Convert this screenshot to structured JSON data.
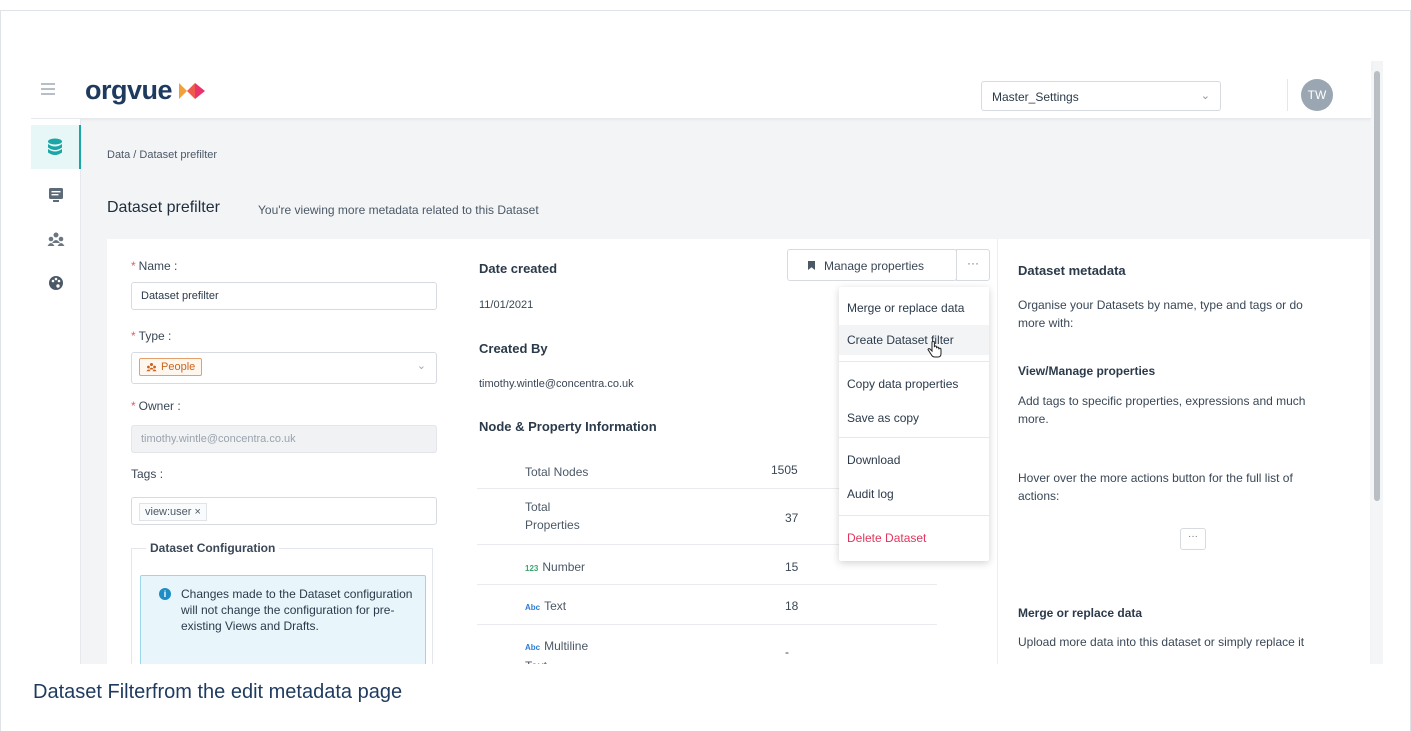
{
  "app": {
    "logo_text": "orgvue",
    "dataset_select": "Master_Settings",
    "avatar_initials": "TW"
  },
  "sidebar": {
    "items": [
      {
        "name": "data",
        "icon": "database-icon",
        "active": true
      },
      {
        "name": "views",
        "icon": "monitor-icon",
        "active": false
      },
      {
        "name": "people",
        "icon": "group-icon",
        "active": false
      },
      {
        "name": "palette",
        "icon": "palette-icon",
        "active": false
      }
    ]
  },
  "breadcrumb": "Data / Dataset prefilter",
  "page": {
    "title": "Dataset prefilter",
    "subtitle": "You're viewing more metadata related to this Dataset"
  },
  "form": {
    "name_label": "Name",
    "name_value": "Dataset prefilter",
    "type_label": "Type",
    "type_value": "People",
    "owner_label": "Owner",
    "owner_value": "timothy.wintle@concentra.co.uk",
    "tags_label": "Tags",
    "tag_value": "view:user",
    "tag_remove": "×",
    "config_title": "Dataset Configuration",
    "config_info": "Changes made to the Dataset configuration will not change the configuration for pre-existing Views and Drafts."
  },
  "details": {
    "date_created_label": "Date created",
    "date_created_value": "11/01/2021",
    "created_by_label": "Created By",
    "created_by_value": "timothy.wintle@concentra.co.uk",
    "node_info_label": "Node & Property Information",
    "rows": [
      {
        "type_badge": "",
        "label": "Total Nodes",
        "value": "1505"
      },
      {
        "type_badge": "",
        "label": "Total Properties",
        "value": "37"
      },
      {
        "type_badge": "123",
        "label": "Number",
        "value": "15"
      },
      {
        "type_badge": "Abc",
        "label": "Text",
        "value": "18"
      },
      {
        "type_badge": "Abc",
        "label": "Multiline Text",
        "value": "-"
      }
    ]
  },
  "actions": {
    "manage_label": "Manage properties",
    "more_label": "···",
    "menu": [
      "Merge or replace data",
      "Create Dataset filter",
      "Copy data properties",
      "Save as copy",
      "Download",
      "Audit log",
      "Delete Dataset"
    ]
  },
  "meta": {
    "title": "Dataset metadata",
    "intro": "Organise your Datasets by name, type and tags or do more with:",
    "vm_title": "View/Manage properties",
    "vm_text": "Add tags to specific properties, expressions and much more.",
    "hover_text": "Hover over the more actions button for the full list of actions:",
    "more_label": "···",
    "merge_title": "Merge or replace data",
    "merge_text": "Upload more data into this dataset or simply replace it"
  },
  "caption": "Dataset Filterfrom the edit metadata page",
  "colors": {
    "accent": "#1aa6a6",
    "brand": "#1f3a5f",
    "danger": "#e0365d",
    "info_bg": "#e8f6fb"
  }
}
